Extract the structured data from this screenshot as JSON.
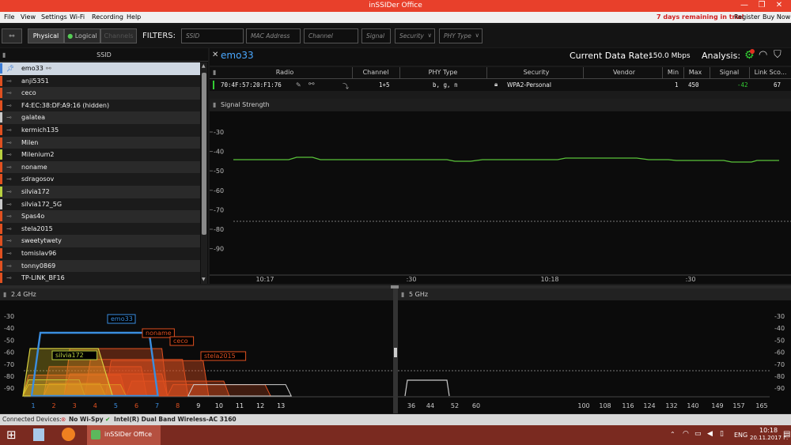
{
  "window": {
    "title": "inSSIDer Office",
    "minimize": "—",
    "maximize": "❐",
    "close": "✕"
  },
  "menu": {
    "items": [
      "File",
      "View",
      "Settings",
      "Wi-Fi",
      "Recording",
      "Help"
    ],
    "trial": "7 days remaining in trial",
    "register": "Register",
    "buy": "Buy Now"
  },
  "toolbar": {
    "physical": "Physical",
    "logical": "Logical",
    "channels": "Channels",
    "filters_label": "FILTERS:",
    "filters": [
      {
        "placeholder": "SSID"
      },
      {
        "placeholder": "MAC Address"
      },
      {
        "placeholder": "Channel"
      },
      {
        "placeholder": "Signal"
      },
      {
        "placeholder": "Security"
      },
      {
        "placeholder": "PHY Type"
      }
    ]
  },
  "ssid_list": {
    "header": "SSID",
    "items": [
      {
        "name": "emo33",
        "color": "#3a7bd5",
        "selected": true
      },
      {
        "name": "anji5351",
        "color": "#e05020"
      },
      {
        "name": "ceco",
        "color": "#e05020"
      },
      {
        "name": "F4:EC:38:DF:A9:16 (hidden)",
        "color": "#e05020"
      },
      {
        "name": "galatea",
        "color": "#c8c8c8"
      },
      {
        "name": "kermich135",
        "color": "#e05020"
      },
      {
        "name": "Milen",
        "color": "#e05020"
      },
      {
        "name": "Milenium2",
        "color": "#b8d040"
      },
      {
        "name": "noname",
        "color": "#e05020"
      },
      {
        "name": "sdragosov",
        "color": "#e05020"
      },
      {
        "name": "silvia172",
        "color": "#b8d040"
      },
      {
        "name": "silvia172_5G",
        "color": "#c8c8c8"
      },
      {
        "name": "Spas4o",
        "color": "#e05020"
      },
      {
        "name": "stela2015",
        "color": "#e05020"
      },
      {
        "name": "sweetytwety",
        "color": "#e05020"
      },
      {
        "name": "tomislav96",
        "color": "#e05020"
      },
      {
        "name": "tonny0869",
        "color": "#e05020"
      },
      {
        "name": "TP-LINK_BF16",
        "color": "#e05020"
      }
    ]
  },
  "detail": {
    "ssid": "emo33",
    "rate_label": "Current Data Rate:",
    "rate_value": "150.0 Mbps",
    "analysis_label": "Analysis:",
    "columns": [
      "Radio",
      "Channel",
      "PHY Type",
      "Security",
      "Vendor",
      "Min",
      "Max",
      "Signal",
      "Link Sco..."
    ],
    "row": {
      "radio": "70:4F:57:20:F1:76",
      "channel": "1+5",
      "phy": "b, g, n",
      "security": "WPA2-Personal",
      "vendor": "",
      "min": "1",
      "max": "450",
      "signal": "-42",
      "link": "67"
    }
  },
  "signal_strength": {
    "title": "Signal Strength",
    "y_ticks": [
      "-30",
      "-40",
      "-50",
      "-60",
      "-70",
      "-80",
      "-90"
    ],
    "x_ticks": [
      "10:17",
      ":30",
      "10:18",
      ":30"
    ]
  },
  "band24": {
    "title": "2.4 GHz",
    "y_ticks": [
      "-30",
      "-40",
      "-50",
      "-60",
      "-70",
      "-80",
      "-90"
    ],
    "channels": [
      {
        "n": "1",
        "color": "#3a8ee0"
      },
      {
        "n": "2",
        "color": "#e05020"
      },
      {
        "n": "3",
        "color": "#e05020"
      },
      {
        "n": "4",
        "color": "#e05020"
      },
      {
        "n": "5",
        "color": "#3a8ee0"
      },
      {
        "n": "6",
        "color": "#e05020"
      },
      {
        "n": "7",
        "color": "#3a8ee0"
      },
      {
        "n": "8",
        "color": "#e05020"
      },
      {
        "n": "9",
        "color": "#e0e0e0"
      },
      {
        "n": "10",
        "color": "#e0e0e0"
      },
      {
        "n": "11",
        "color": "#e0e0e0"
      },
      {
        "n": "12",
        "color": "#e0e0e0"
      },
      {
        "n": "13",
        "color": "#e0e0e0"
      }
    ],
    "labels": [
      {
        "text": "emo33",
        "color": "#3a8ee0"
      },
      {
        "text": "noname",
        "color": "#e05020"
      },
      {
        "text": "ceco",
        "color": "#e05020"
      },
      {
        "text": "silvia172",
        "color": "#b8d040"
      },
      {
        "text": "stela2015",
        "color": "#e05020"
      }
    ]
  },
  "band5": {
    "title": "5 GHz",
    "y_ticks": [
      "-30",
      "-40",
      "-50",
      "-60",
      "-70",
      "-80",
      "-90"
    ],
    "channels": [
      "36",
      "44",
      "52",
      "60",
      "100",
      "108",
      "116",
      "124",
      "132",
      "140",
      "149",
      "157",
      "165"
    ]
  },
  "status": {
    "label": "Connected Devices:",
    "device1": "No Wi-Spy",
    "device2": "Intel(R) Dual Band Wireless-AC 3160"
  },
  "taskbar": {
    "app": "inSSIDer Office",
    "lang": "ENG",
    "time": "10:18",
    "date": "20.11.2017 г."
  }
}
